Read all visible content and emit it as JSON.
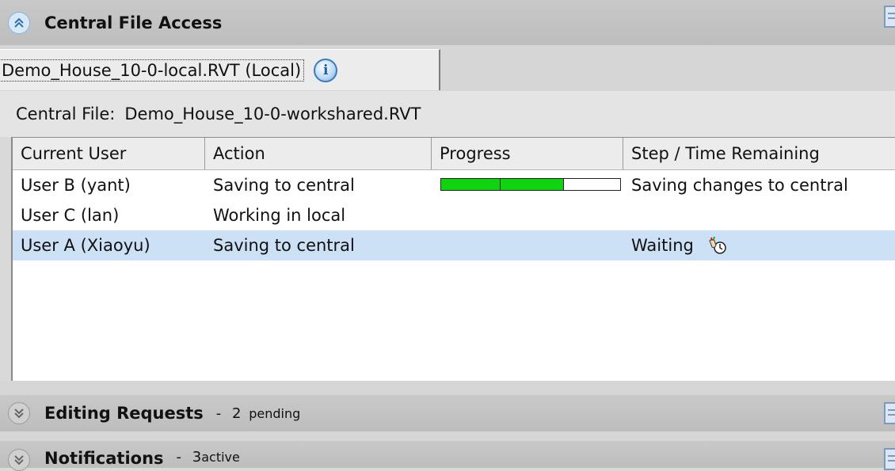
{
  "central_file_access": {
    "title": "Central File Access"
  },
  "file_tab": {
    "label": "Demo_House_10-0-local.RVT (Local)",
    "info_icon": "i"
  },
  "central_file": {
    "label": "Central File:",
    "value": "Demo_House_10-0-workshared.RVT"
  },
  "table": {
    "columns": [
      "Current User",
      "Action",
      "Progress",
      "Step / Time Remaining"
    ],
    "rows": [
      {
        "user": "User B (yant)",
        "action": "Saving to central",
        "progress": 0.68,
        "step": "Saving changes to central"
      },
      {
        "user": "User C (lan)",
        "action": "Working in local",
        "step": ""
      },
      {
        "user": "User A (Xiaoyu)",
        "action": "Saving to central",
        "step": "Waiting",
        "step_icon": "waiting-hand-icon"
      }
    ]
  },
  "editing_requests": {
    "title": "Editing Requests",
    "separator": "-",
    "count": "2",
    "count_suffix": "pending"
  },
  "notifications": {
    "title": "Notifications",
    "separator": "-",
    "count": "3",
    "count_suffix": "active"
  },
  "colors": {
    "progress_fill": "#0fd40f",
    "selected_row": "#cce0f6",
    "section_header": "#c4c4c4"
  }
}
